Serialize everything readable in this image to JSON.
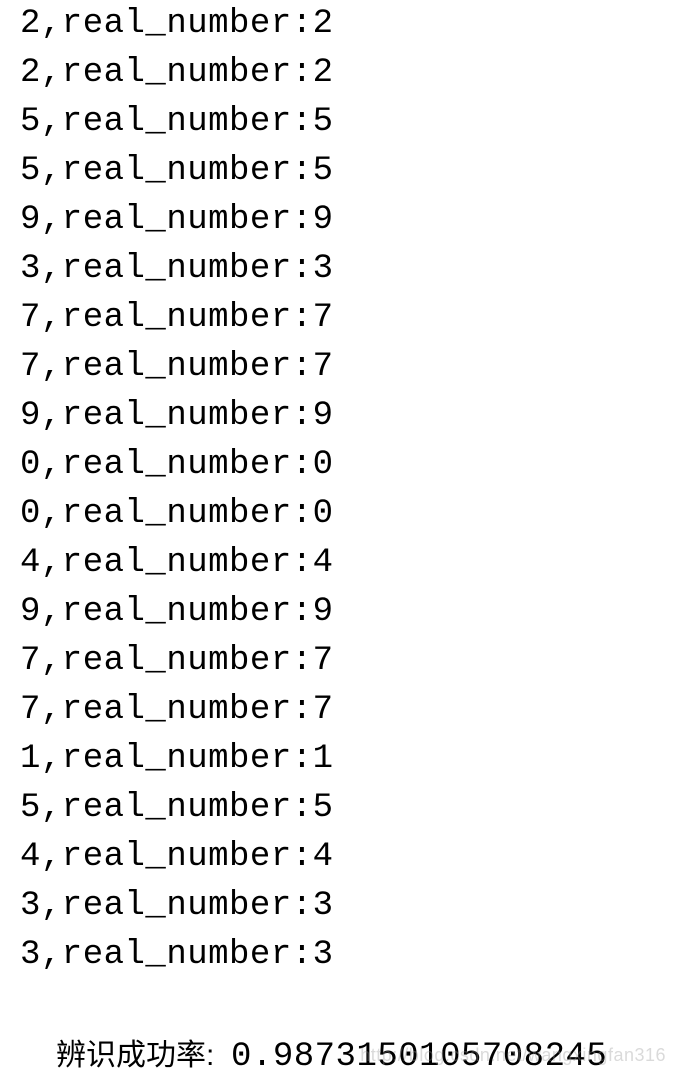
{
  "lines": [
    {
      "predicted": "2",
      "label": "real_number",
      "actual": "2"
    },
    {
      "predicted": "2",
      "label": "real_number",
      "actual": "2"
    },
    {
      "predicted": "5",
      "label": "real_number",
      "actual": "5"
    },
    {
      "predicted": "5",
      "label": "real_number",
      "actual": "5"
    },
    {
      "predicted": "9",
      "label": "real_number",
      "actual": "9"
    },
    {
      "predicted": "3",
      "label": "real_number",
      "actual": "3"
    },
    {
      "predicted": "7",
      "label": "real_number",
      "actual": "7"
    },
    {
      "predicted": "7",
      "label": "real_number",
      "actual": "7"
    },
    {
      "predicted": "9",
      "label": "real_number",
      "actual": "9"
    },
    {
      "predicted": "0",
      "label": "real_number",
      "actual": "0"
    },
    {
      "predicted": "0",
      "label": "real_number",
      "actual": "0"
    },
    {
      "predicted": "4",
      "label": "real_number",
      "actual": "4"
    },
    {
      "predicted": "9",
      "label": "real_number",
      "actual": "9"
    },
    {
      "predicted": "7",
      "label": "real_number",
      "actual": "7"
    },
    {
      "predicted": "7",
      "label": "real_number",
      "actual": "7"
    },
    {
      "predicted": "1",
      "label": "real_number",
      "actual": "1"
    },
    {
      "predicted": "5",
      "label": "real_number",
      "actual": "5"
    },
    {
      "predicted": "4",
      "label": "real_number",
      "actual": "4"
    },
    {
      "predicted": "3",
      "label": "real_number",
      "actual": "3"
    },
    {
      "predicted": "3",
      "label": "real_number",
      "actual": "3"
    }
  ],
  "summary": {
    "label": "辨识成功率:  ",
    "value": "0.9873150105708245"
  },
  "watermark": "http://blog.csdn.net/wangxingfan316"
}
